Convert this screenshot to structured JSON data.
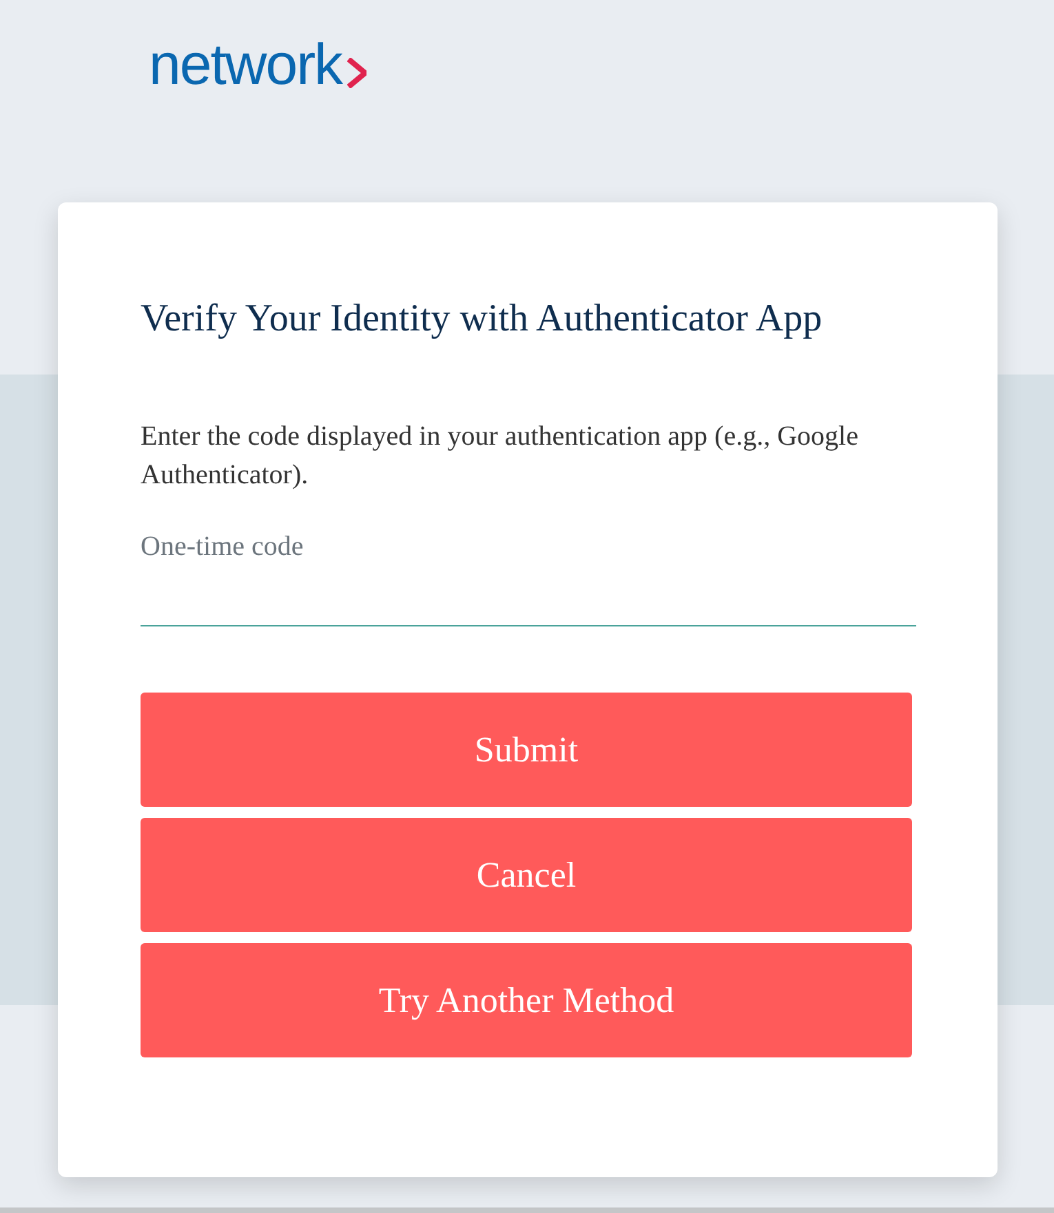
{
  "logo": {
    "text": "network"
  },
  "card": {
    "title": "Verify Your Identity with Authenticator App",
    "description": "Enter the code displayed in your authentication app (e.g., Google Authenticator).",
    "field": {
      "label": "One-time code"
    },
    "buttons": [
      {
        "label": "Submit"
      },
      {
        "label": "Cancel"
      },
      {
        "label": "Try Another Method"
      }
    ]
  }
}
